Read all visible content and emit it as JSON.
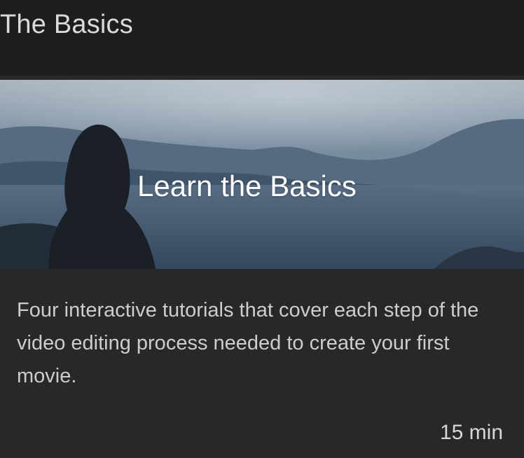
{
  "section": {
    "title": "The Basics"
  },
  "card": {
    "thumbnail_title": "Learn the Basics",
    "description": "Four interactive tutorials that cover each step of the video editing process needed to create your first movie.",
    "duration": "15 min"
  },
  "colors": {
    "background": "#1f1d1e",
    "card_background": "#2a2728",
    "text_primary": "#dcd9da",
    "text_body": "#cfcccd"
  }
}
